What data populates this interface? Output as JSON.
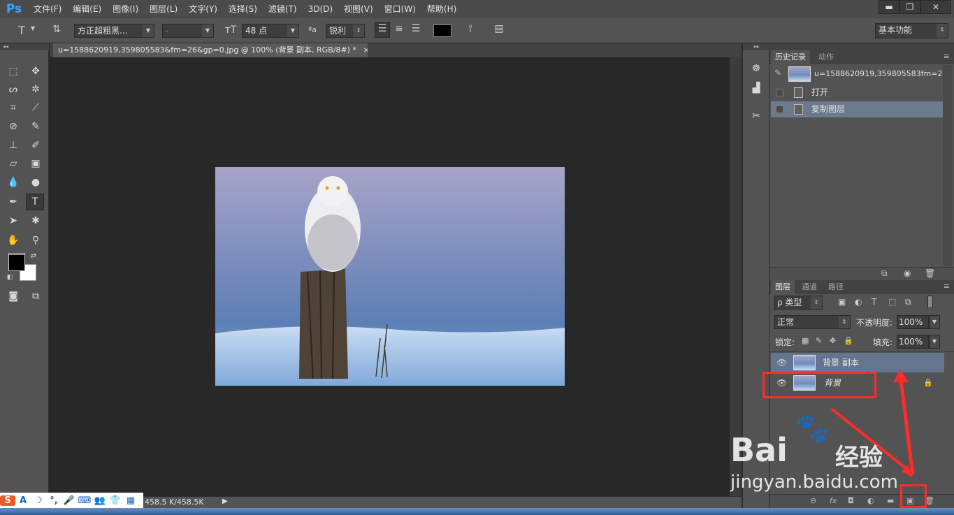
{
  "app": {
    "logo": "Ps"
  },
  "menu": [
    "文件(F)",
    "编辑(E)",
    "图像(I)",
    "图层(L)",
    "文字(Y)",
    "选择(S)",
    "滤镜(T)",
    "3D(D)",
    "视图(V)",
    "窗口(W)",
    "帮助(H)"
  ],
  "window_controls": {
    "minimize": "▬",
    "restore": "❐",
    "close": "✕"
  },
  "options": {
    "tool_icon": "T",
    "font_family": "方正超粗黑...",
    "font_style": "-",
    "font_size": "48 点",
    "aa_label": "ªa",
    "antialias": "锐利",
    "workspace": "基本功能"
  },
  "document": {
    "tab_title": "u=1588620919,359805583&fm=26&gp=0.jpg @ 100% (背景 副本, RGB/8#) *",
    "tab_close": "×"
  },
  "status": {
    "doc_size": "458.5 K/458.5K",
    "arrow": "▶"
  },
  "ime": {
    "icons": [
      "S",
      "A",
      "☽",
      "°,",
      "🎤",
      "⌨",
      "👥",
      "👕",
      "▦"
    ]
  },
  "history_panel": {
    "tabs": [
      "历史记录",
      "动作"
    ],
    "snapshot_label": "u=1588620919,359805583fm=2...",
    "items": [
      {
        "label": "打开",
        "selected": false
      },
      {
        "label": "复制图层",
        "selected": true
      }
    ]
  },
  "layers_panel": {
    "tabs": [
      "图层",
      "通道",
      "路径"
    ],
    "filter_kind": "ρ 类型",
    "blend_mode": "正常",
    "opacity_label": "不透明度:",
    "opacity_value": "100%",
    "lock_label": "锁定:",
    "fill_label": "填充:",
    "fill_value": "100%",
    "layers": [
      {
        "name": "背景 副本",
        "selected": true,
        "locked": false
      },
      {
        "name": "背景",
        "selected": false,
        "locked": true
      }
    ],
    "footer_icons": [
      "⊖",
      "fx",
      "◘",
      "◐",
      "▬",
      "▣",
      "🗑"
    ]
  },
  "watermark": {
    "brand": "Bai",
    "brand2": "经验",
    "url": "jingyan.baidu.com"
  },
  "colors": {
    "accent_red": "#ff2b2b",
    "ps_blue": "#31a8ff"
  }
}
